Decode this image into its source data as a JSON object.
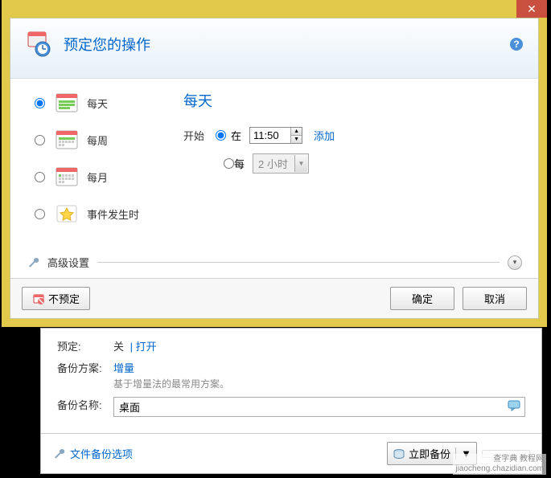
{
  "modal": {
    "title": "预定您的操作",
    "frequencies": {
      "daily": "每天",
      "weekly": "每周",
      "monthly": "每月",
      "event": "事件发生时"
    },
    "rightTitle": "每天",
    "startLabel": "开始",
    "atLabel": "在",
    "timeValue": "11:50",
    "addLabel": "添加",
    "everyLabel": "每",
    "intervalValue": "2 小时",
    "advancedLabel": "高级设置",
    "noScheduleBtn": "不预定",
    "okBtn": "确定",
    "cancelBtn": "取消"
  },
  "lower": {
    "scheduleLabel": "预定:",
    "scheduleOff": "关",
    "scheduleOpen": "打开",
    "schemeLabel": "备份方案:",
    "schemeValue": "增量",
    "schemeHint": "基于增量法的最常用方案。",
    "nameLabel": "备份名称:",
    "nameValue": "桌面",
    "fileOptions": "文件备份选项",
    "backupNow": "立即备份"
  },
  "watermark": {
    "l1": "查字典 教程网",
    "l2": "jiaocheng.chazidian.com"
  }
}
